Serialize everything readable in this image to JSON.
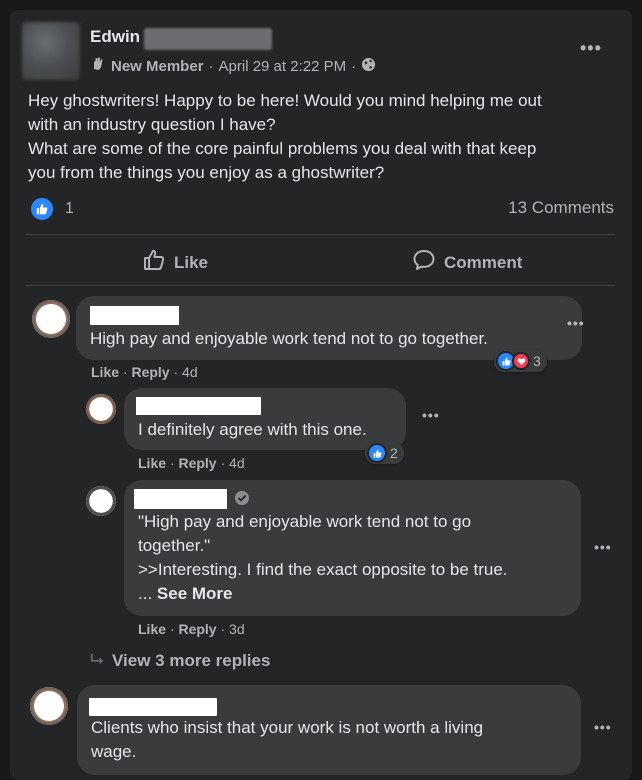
{
  "post": {
    "author_first": "Edwin",
    "badge": "New Member",
    "time": "April 29 at 2:22 PM",
    "separator": "·",
    "body_lines": [
      "Hey ghostwriters! Happy to be here! Would you mind helping me out",
      "with an industry question I have?",
      "What are some of the core painful problems you deal with that keep",
      "you from the things you enjoy as a ghostwriter?"
    ],
    "reaction_count": "1",
    "comments_count": "13 Comments",
    "more_label": "•••"
  },
  "actions": {
    "like_label": "Like",
    "comment_label": "Comment"
  },
  "comments": [
    {
      "text_lines": [
        "High pay and enjoyable work tend not to go together."
      ],
      "like": "Like",
      "reply": "Reply",
      "age": "4d",
      "reaction_count": "3"
    },
    {
      "text_lines": [
        "I definitely agree with this one."
      ],
      "like": "Like",
      "reply": "Reply",
      "age": "4d",
      "reaction_count": "2"
    },
    {
      "text_lines": [
        "\"High pay and enjoyable work tend not to go",
        "together.\"",
        ">>Interesting. I find the exact opposite to be true."
      ],
      "see_more_prefix": "... ",
      "see_more": "See More",
      "like": "Like",
      "reply": "Reply",
      "age": "3d"
    },
    {
      "text_lines": [
        "Clients who insist that your work is not worth a living",
        "wage."
      ]
    }
  ],
  "view_more_replies": "View 3 more replies",
  "colors": {
    "background": "#18191a",
    "card": "#242526",
    "bubble": "#3a3b3c",
    "text": "#e4e6eb",
    "muted": "#b0b3b8",
    "like_blue": "#2d88ff",
    "love_red": "#f33e58"
  },
  "icons": [
    "badge-wave-icon",
    "globe-icon",
    "like-reaction-icon",
    "love-reaction-icon",
    "thumbs-up-icon",
    "comment-icon",
    "reply-arrow-icon",
    "verified-badge-icon",
    "more-options-icon"
  ]
}
